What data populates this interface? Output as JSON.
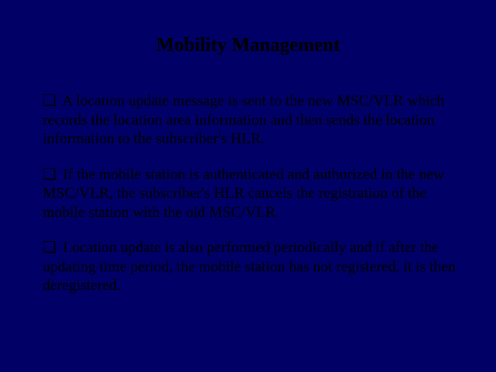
{
  "slide": {
    "title": "Mobility Management",
    "bullet_marker": "❑",
    "bullets": [
      "A location update message is sent to the new MSC/VLR which records the location area information and then sends the location information to the subscriber's HLR.",
      "If the mobile station is authenticated and authorized in the new MSC/VLR, the subscriber's HLR cancels the registration of the mobile station with the old MSC/VLR.",
      "Location update is also performed periodically and if after the updating time period, the mobile station has not registered, it is then deregistered."
    ]
  }
}
